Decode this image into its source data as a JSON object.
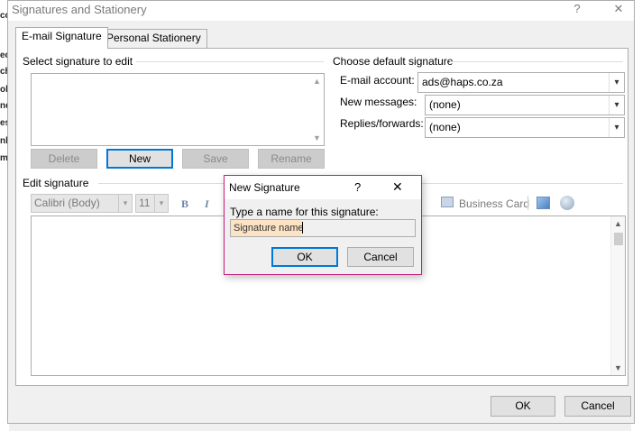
{
  "window": {
    "title": "Signatures and Stationery",
    "help_label": "?",
    "close_label": "✕"
  },
  "tabs": [
    {
      "label": "E-mail Signature",
      "active": true
    },
    {
      "label": "Personal Stationery",
      "active": false
    }
  ],
  "select_section": {
    "label": "Select signature to edit",
    "buttons": {
      "delete": "Delete",
      "new": "New",
      "save": "Save",
      "rename": "Rename"
    }
  },
  "default_section": {
    "label": "Choose default signature",
    "email_account_label": "E-mail account:",
    "email_account_value": "ads@haps.co.za",
    "new_messages_label": "New messages:",
    "new_messages_value": "(none)",
    "replies_label": "Replies/forwards:",
    "replies_value": "(none)"
  },
  "edit_section": {
    "label": "Edit signature",
    "font_name": "Calibri (Body)",
    "font_size": "11",
    "bold_label": "B",
    "italic_label": "I",
    "business_card_label": "Business Card"
  },
  "dialog": {
    "title": "New Signature",
    "help_label": "?",
    "close_label": "✕",
    "prompt": "Type a name for this signature:",
    "input_value": "Signature name",
    "ok_label": "OK",
    "cancel_label": "Cancel"
  },
  "footer": {
    "ok_label": "OK",
    "cancel_label": "Cancel"
  },
  "background_snippets": [
    "cc",
    "ec",
    "ch",
    "ok",
    "nd",
    "es",
    "nk",
    "mi"
  ],
  "colors": {
    "accent_border": "#0078d7",
    "dialog_border": "#c21e7c",
    "placeholder_highlight": "#fbe3c4"
  }
}
